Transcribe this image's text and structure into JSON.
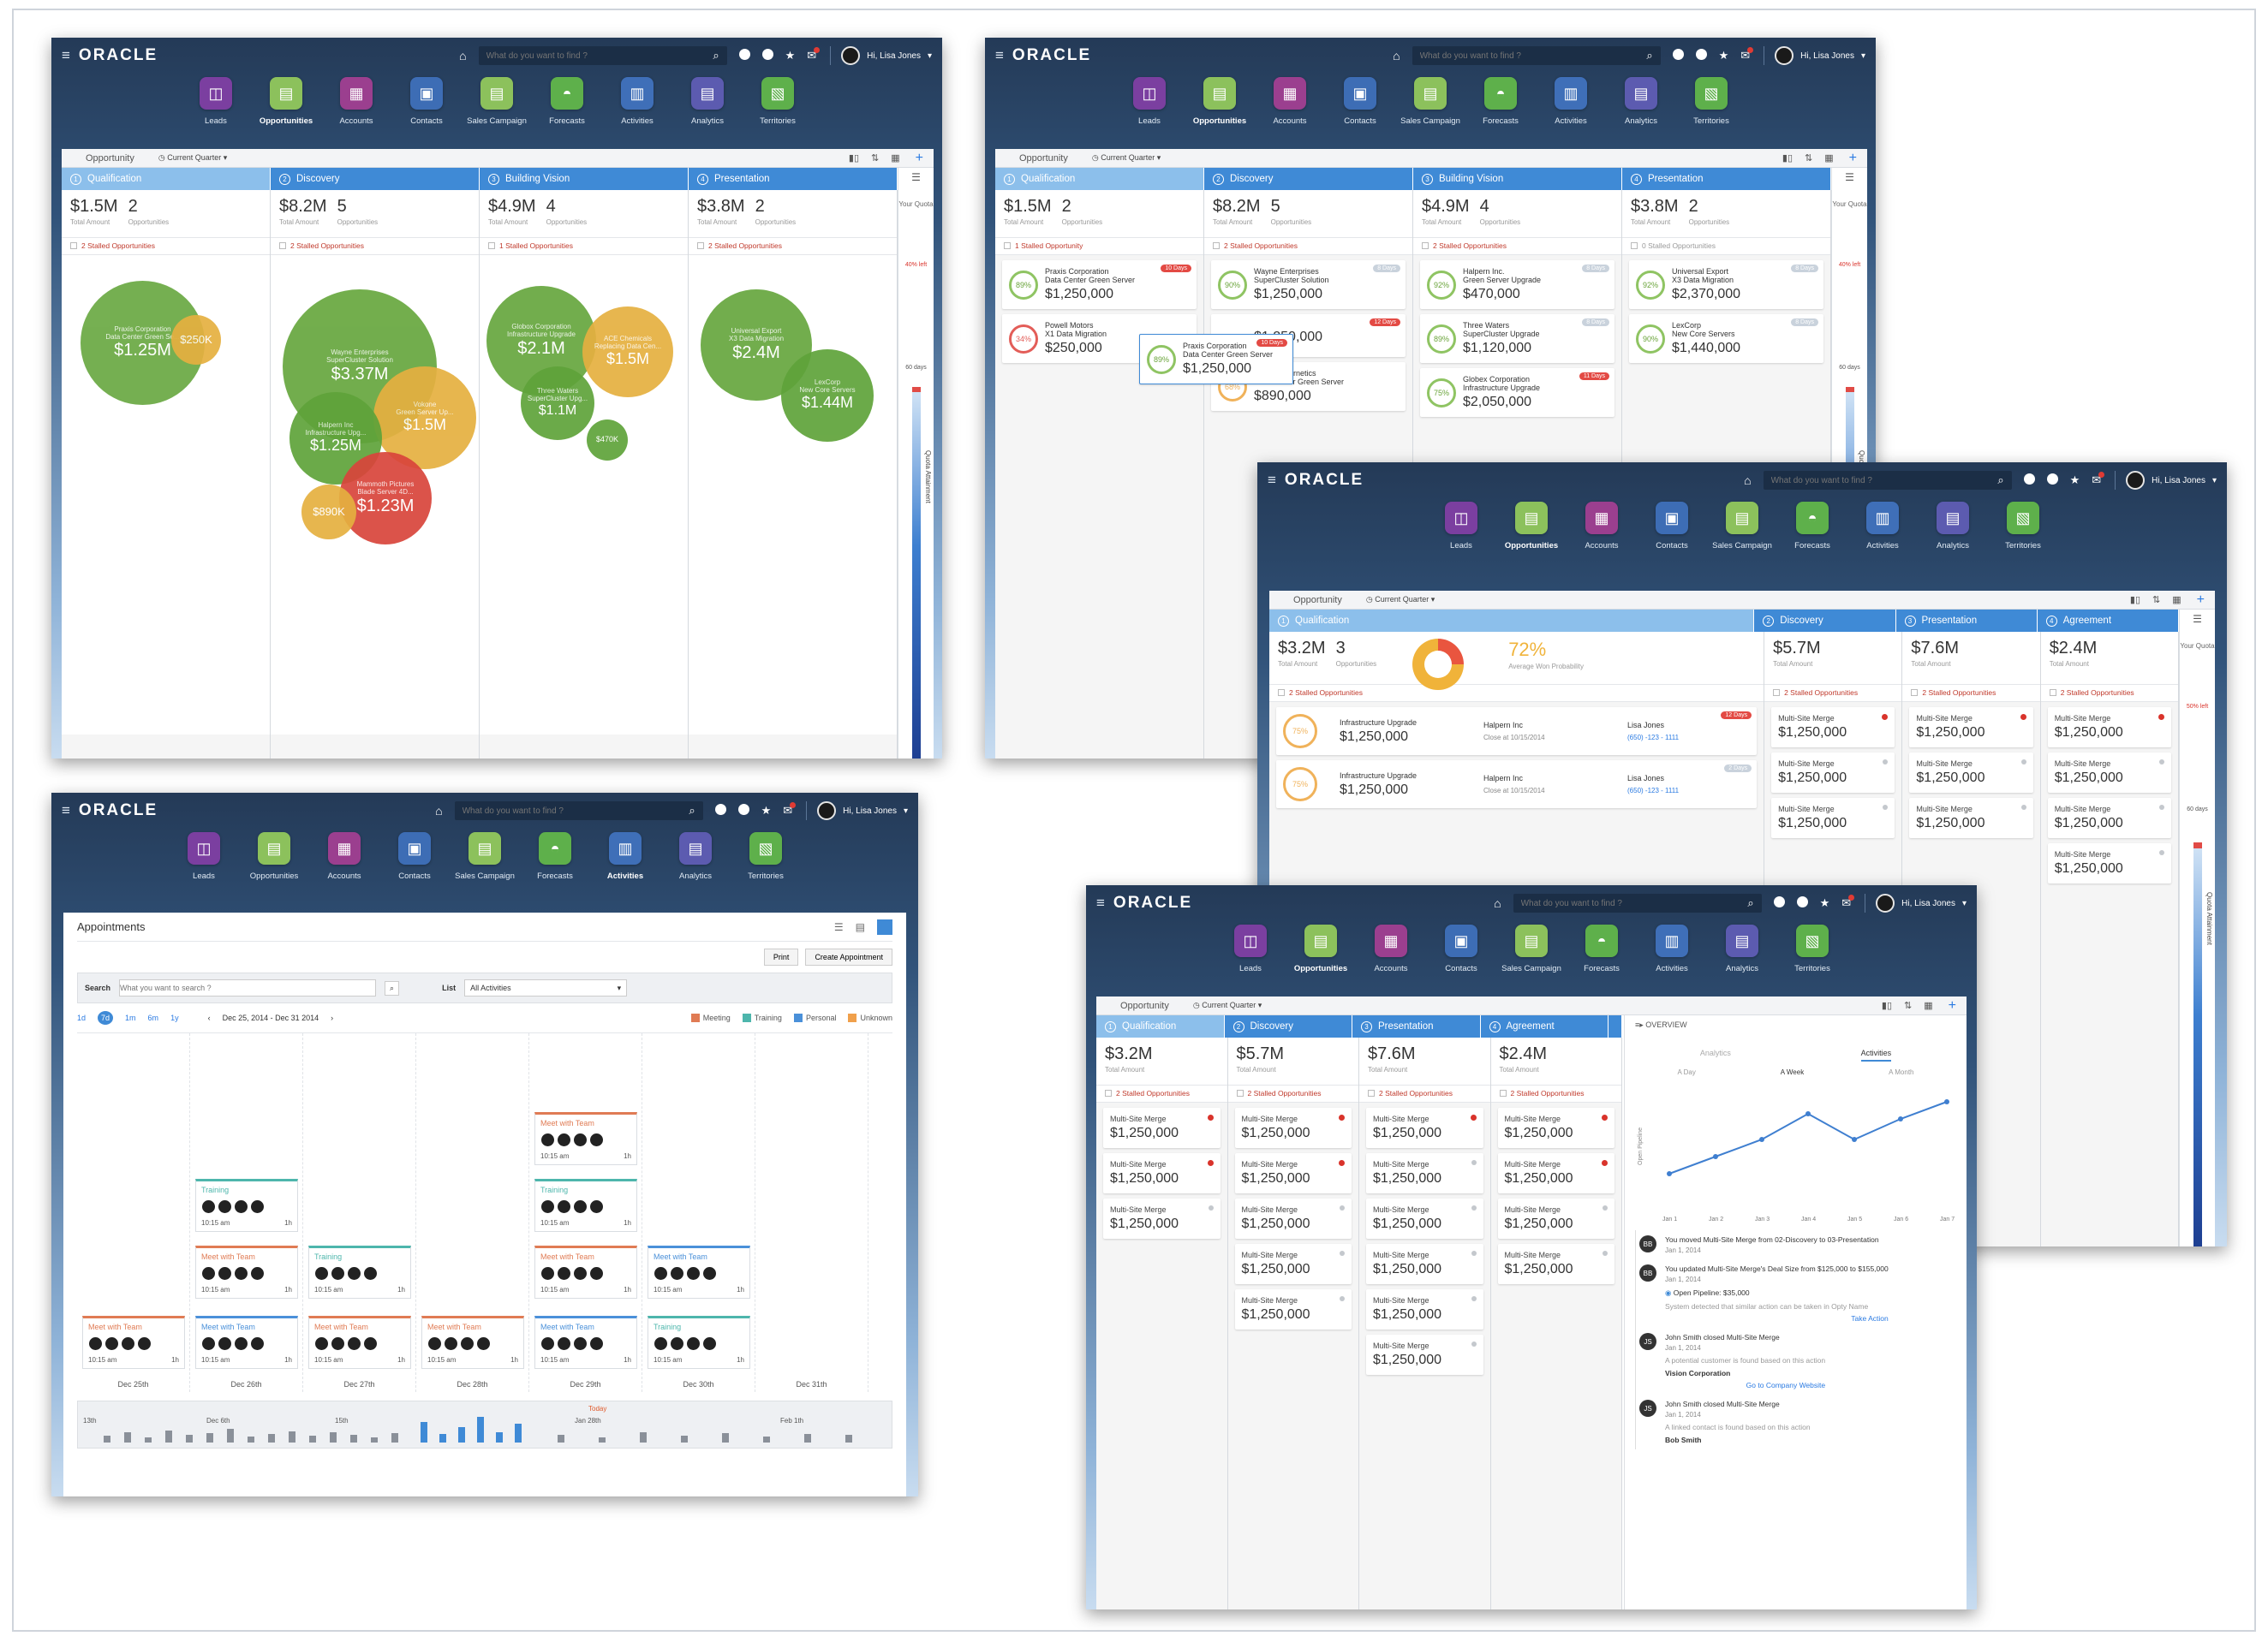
{
  "brand": {
    "logo": "ORACLE",
    "search_placeholder": "What do you want to find ?",
    "user": "Hi, Lisa Jones"
  },
  "nav": [
    {
      "label": "Leads",
      "color": "#7b3fa0",
      "icon": "inbox-icon",
      "glyph": "◫"
    },
    {
      "label": "Opportunities",
      "color": "#8cc15c",
      "icon": "opportunity-icon",
      "glyph": "▤"
    },
    {
      "label": "Accounts",
      "color": "#9b3f8f",
      "icon": "building-icon",
      "glyph": "▦"
    },
    {
      "label": "Contacts",
      "color": "#3d6db5",
      "icon": "contact-card-icon",
      "glyph": "▣"
    },
    {
      "label": "Sales Campaign",
      "color": "#8cc15c",
      "icon": "campaign-icon",
      "glyph": "▤"
    },
    {
      "label": "Forecasts",
      "color": "#5eb04b",
      "icon": "forecast-icon",
      "glyph": "◓"
    },
    {
      "label": "Activities",
      "color": "#3f6fb8",
      "icon": "activities-icon",
      "glyph": "▥"
    },
    {
      "label": "Analytics",
      "color": "#5c5bb0",
      "icon": "analytics-icon",
      "glyph": "▤"
    },
    {
      "label": "Territories",
      "color": "#5eb04b",
      "icon": "territory-icon",
      "glyph": "▧"
    }
  ],
  "opp": {
    "title": "Opportunity",
    "period": "Current Quarter",
    "quota_label": "Your Quota",
    "quota_left": "40% left",
    "quota_days": "60 days",
    "quota_vertical": "Quota Attainment"
  },
  "stages": [
    {
      "n": "1",
      "name": "Qualification",
      "amount": "$1.5M",
      "count": "2",
      "stalled": "2 Stalled Opportunities"
    },
    {
      "n": "2",
      "name": "Discovery",
      "amount": "$8.2M",
      "count": "5",
      "stalled": "2 Stalled Opportunities"
    },
    {
      "n": "3",
      "name": "Building Vision",
      "amount": "$4.9M",
      "count": "4",
      "stalled": "1 Stalled Opportunities"
    },
    {
      "n": "4",
      "name": "Presentation",
      "amount": "$3.8M",
      "count": "2",
      "stalled": "2 Stalled Opportunities"
    }
  ],
  "labels": {
    "total": "Total Amount",
    "opps": "Opportunities"
  },
  "bubbles": [
    {
      "name": "Praxis Corporation",
      "sub": "Data Center Green Se...",
      "amt": "$1.25M"
    },
    {
      "name": "",
      "sub": "",
      "amt": "$250K"
    },
    {
      "name": "Wayne Enterprises",
      "sub": "SuperCluster Solution",
      "amt": "$3.37M"
    },
    {
      "name": "Vokone",
      "sub": "Green Server Up...",
      "amt": "$1.5M"
    },
    {
      "name": "Halpern Inc",
      "sub": "Infrastructure Upg...",
      "amt": "$1.25M"
    },
    {
      "name": "Mammoth Pictures",
      "sub": "Blade Server 4D...",
      "amt": "$1.23M"
    },
    {
      "name": "",
      "sub": "",
      "amt": "$890K"
    },
    {
      "name": "Globox Corporation",
      "sub": "Infrastructure Upgrade",
      "amt": "$2.1M"
    },
    {
      "name": "ACE Chemicals",
      "sub": "Replacing Data Cen...",
      "amt": "$1.5M"
    },
    {
      "name": "Three Waters",
      "sub": "SuperCluster Upg...",
      "amt": "$1.1M"
    },
    {
      "name": "",
      "sub": "",
      "amt": "$470K"
    },
    {
      "name": "Universal Export",
      "sub": "X3 Data Migration",
      "amt": "$2.4M"
    },
    {
      "name": "LexCorp",
      "sub": "New Core Servers",
      "amt": "$1.44M"
    }
  ],
  "s2": {
    "stalled": [
      "1 Stalled Opportunity",
      "2 Stalled Opportunities",
      "2 Stalled Opportunities",
      "0 Stalled Opportunities"
    ],
    "cards": [
      [
        {
          "pct": "89%",
          "co": "Praxis Corporation",
          "d": "Data Center Green Server",
          "amt": "$1,250,000",
          "chip": "10 Days"
        },
        {
          "pct": "34%",
          "co": "Powell Motors",
          "d": "X1 Data Migration",
          "amt": "$250,000",
          "chip": ""
        }
      ],
      [
        {
          "pct": "90%",
          "co": "Wayne Enterprises",
          "d": "SuperCluster Solution",
          "amt": "$1,250,000",
          "chip": "8 Days"
        },
        {
          "pct": "",
          "co": "",
          "d": "",
          "amt": "$1,250,000",
          "chip": "12 Days"
        },
        {
          "pct": "68%",
          "co": "Sirius Cybernetics",
          "d": "Data Center Green Server",
          "amt": "$890,000",
          "chip": ""
        }
      ],
      [
        {
          "pct": "92%",
          "co": "Halpern Inc.",
          "d": "Green Server Upgrade",
          "amt": "$470,000",
          "chip": "8 Days"
        },
        {
          "pct": "89%",
          "co": "Three Waters",
          "d": "SuperCluster Upgrade",
          "amt": "$1,120,000",
          "chip": "8 Days"
        },
        {
          "pct": "75%",
          "co": "Globex Corporation",
          "d": "Infrastructure Upgrade",
          "amt": "$2,050,000",
          "chip": "11 Days"
        }
      ],
      [
        {
          "pct": "92%",
          "co": "Universal Export",
          "d": "X3 Data Migration",
          "amt": "$2,370,000",
          "chip": "8 Days"
        },
        {
          "pct": "90%",
          "co": "LexCorp",
          "d": "New Core Servers",
          "amt": "$1,440,000",
          "chip": "8 Days"
        }
      ]
    ],
    "drag": {
      "pct": "89%",
      "co": "Praxis Corporation",
      "d": "Data Center Green Server",
      "amt": "$1,250,000",
      "chip": "10 Days"
    }
  },
  "s3": {
    "stages": [
      {
        "n": "1",
        "name": "Qualification"
      },
      {
        "n": "2",
        "name": "Discovery"
      },
      {
        "n": "3",
        "name": "Presentation"
      },
      {
        "n": "4",
        "name": "Agreement"
      }
    ],
    "sums": [
      {
        "amt": "$3.2M",
        "count": "3",
        "stalled": "2 Stalled Opportunities"
      },
      {
        "amt": "$5.7M",
        "stalled": "2 Stalled Opportunities"
      },
      {
        "amt": "$7.6M",
        "stalled": "2 Stalled Opportunities"
      },
      {
        "amt": "$2.4M",
        "stalled": "2 Stalled Opportunities"
      }
    ],
    "win": {
      "pct": "72%",
      "label": "Average Won Probability"
    },
    "rows": [
      {
        "pct": "75%",
        "title": "Infrastructure Upgrade",
        "amt": "$1,250,000",
        "acct": "Halpern Inc",
        "close": "Close at 10/15/2014",
        "owner": "Lisa Jones",
        "phone": "(650) -123 - 1111",
        "chip": "12 Days"
      },
      {
        "pct": "75%",
        "title": "Infrastructure Upgrade",
        "amt": "$1,250,000",
        "acct": "Halpern Inc",
        "close": "Close at 10/15/2014",
        "owner": "Lisa Jones",
        "phone": "(650) -123 - 1111",
        "chip": "2 Days"
      }
    ],
    "ms": "Multi-Site Merge",
    "amt": "$1,250,000",
    "quota_left": "50% left"
  },
  "s4": {
    "title": "Appointments",
    "print": "Print",
    "create": "Create Appointment",
    "search_label": "Search",
    "search_ph": "What you want to search ?",
    "list_label": "List",
    "list_val": "All Activities",
    "ranges": [
      "1d",
      "7d",
      "1m",
      "6m",
      "1y"
    ],
    "period": "Dec 25, 2014 - Dec 31 2014",
    "legend": [
      {
        "name": "Meeting",
        "color": "#e07b54"
      },
      {
        "name": "Training",
        "color": "#4db6ac"
      },
      {
        "name": "Personal",
        "color": "#4a90d9"
      },
      {
        "name": "Unknown",
        "color": "#f0a04b"
      }
    ],
    "days": [
      "Dec 25th",
      "Dec 26th",
      "Dec 27th",
      "Dec 28th",
      "Dec 29th",
      "Dec 30th",
      "Dec 31th"
    ],
    "time": "10:15 am",
    "dur": "1h",
    "today": "Today",
    "events": {
      "meet": "Meet with Team",
      "train": "Training"
    },
    "mini": [
      "13th",
      "Dec 6th",
      "15th",
      "Jan 28th",
      "Feb 1th"
    ]
  },
  "s5": {
    "stages": [
      {
        "n": "1",
        "name": "Qualification",
        "amt": "$3.2M"
      },
      {
        "n": "2",
        "name": "Discovery",
        "amt": "$5.7M"
      },
      {
        "n": "3",
        "name": "Presentation",
        "amt": "$7.6M"
      },
      {
        "n": "4",
        "name": "Agreement",
        "amt": "$2.4M"
      }
    ],
    "stalled": "2 Stalled Opportunities",
    "overview": "OVERVIEW",
    "tabs": [
      "Analytics",
      "Activities"
    ],
    "periods": [
      "A Day",
      "A Week",
      "A Month"
    ],
    "ylabel": "Open Pipeline",
    "chart_data": {
      "type": "line",
      "x": [
        "Jan 1",
        "Jan 2",
        "Jan 3",
        "Jan 4",
        "Jan 5",
        "Jan 6",
        "Jan 7"
      ],
      "values": [
        2,
        3,
        4,
        5.5,
        4,
        5.2,
        6.2
      ]
    },
    "feed": [
      {
        "who": "BB",
        "text": "You moved Multi-Site Merge from 02-Discovery to 03-Presentation",
        "date": "Jan 1, 2014"
      },
      {
        "who": "BB",
        "text": "You updated Multi-Site Merge's Deal Size from $125,000 to $155,000",
        "date": "Jan 1, 2014",
        "sub": "Open Pipeline: $35,000",
        "note": "System detected that similar action can be taken in Opty Name",
        "link": "Take Action"
      },
      {
        "who": "JS",
        "text": "John Smith closed Multi-Site Merge",
        "date": "Jan 1, 2014",
        "note": "A potential customer is found based on this action",
        "extra": "Vision Corporation",
        "link": "Go to Company Website"
      },
      {
        "who": "JS",
        "text": "John Smith closed Multi-Site Merge",
        "date": "Jan 1, 2014",
        "note": "A linked contact is found based on this action",
        "extra": "Bob Smith"
      }
    ]
  }
}
